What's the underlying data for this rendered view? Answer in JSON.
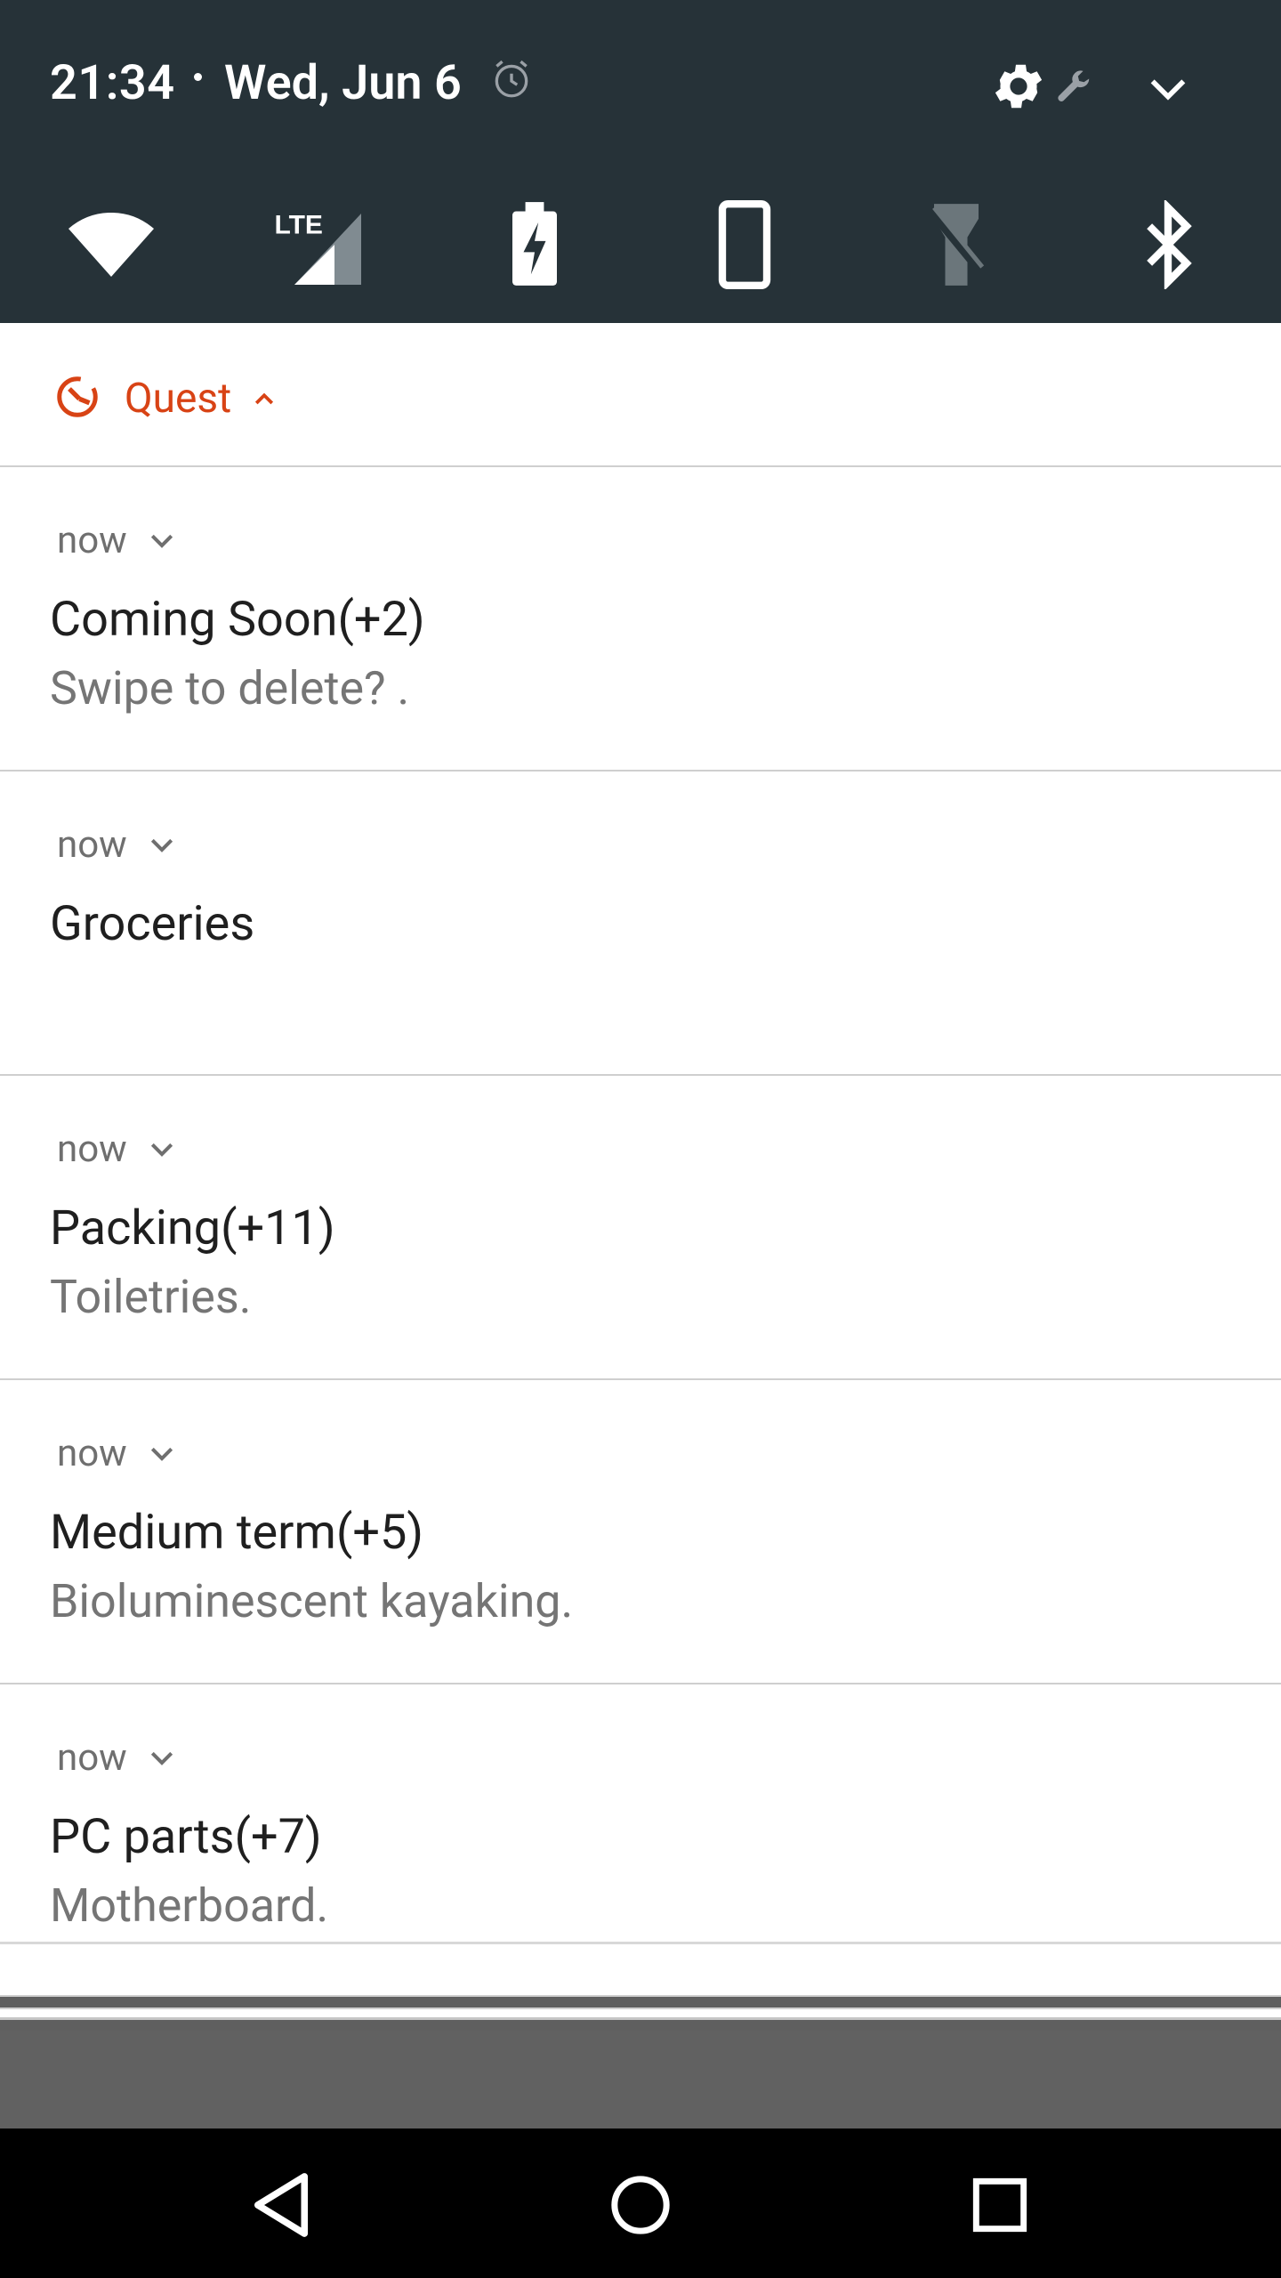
{
  "status": {
    "time": "21:34",
    "date": "Wed, Jun 6",
    "icons": [
      "alarm-icon",
      "settings-gear-icon",
      "wrench-icon",
      "chevron-down-icon"
    ]
  },
  "quick_tiles": [
    "wifi-icon",
    "lte-signal-icon",
    "battery-saver-icon",
    "auto-rotate-icon",
    "flashlight-off-icon",
    "bluetooth-icon"
  ],
  "tiles_text": {
    "lte_label": "LTE"
  },
  "app": {
    "name": "Quest",
    "accent": "#d84315"
  },
  "notifications": [
    {
      "time": "now",
      "title": "Coming Soon(+2)",
      "text": "Swipe to delete? ."
    },
    {
      "time": "now",
      "title": "Groceries",
      "text": ""
    },
    {
      "time": "now",
      "title": "Packing(+11)",
      "text": "Toiletries."
    },
    {
      "time": "now",
      "title": "Medium term(+5)",
      "text": "Bioluminescent kayaking."
    },
    {
      "time": "now",
      "title": "PC parts(+7)",
      "text": "Motherboard."
    }
  ],
  "nav": [
    "back-icon",
    "home-icon",
    "recents-icon"
  ]
}
